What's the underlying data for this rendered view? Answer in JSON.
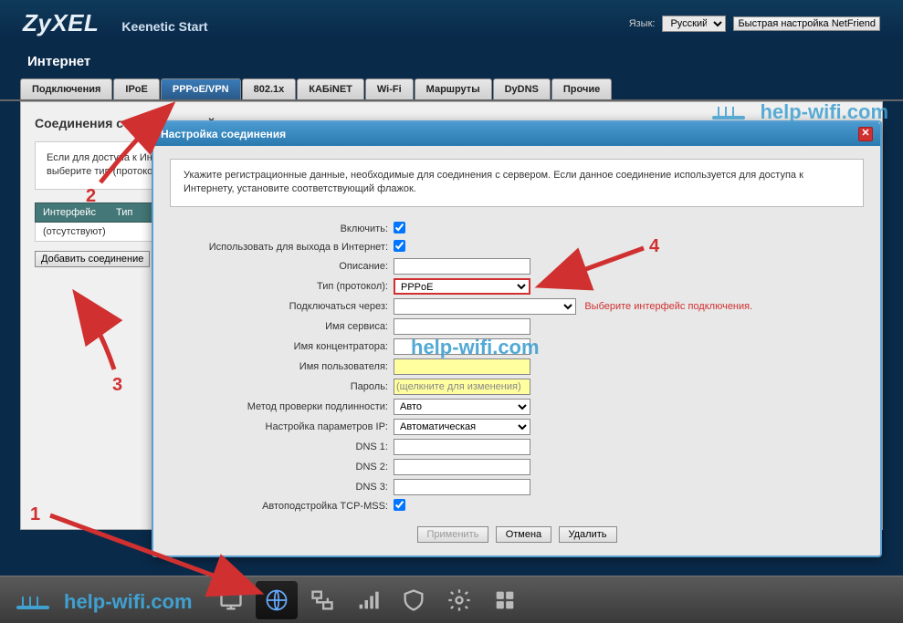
{
  "header": {
    "logo": "ZyXEL",
    "model": "Keenetic Start",
    "lang_label": "Язык:",
    "lang_value": "Русский",
    "quicksetup": "Быстрая настройка NetFriend"
  },
  "page_title": "Интернет",
  "tabs": [
    "Подключения",
    "IPoE",
    "PPPoE/VPN",
    "802.1x",
    "КАБiNET",
    "Wi-Fi",
    "Маршруты",
    "DyDNS",
    "Прочие"
  ],
  "active_tab_index": 2,
  "panel": {
    "title": "Соединения с авторизацией",
    "info": "Если для доступа к Интернету требуется установить авторизованное соединение, настройте его здесь. Укажите данные, предоставленные вам поставщиком услуг, выберите тип (протокол) соединения и подключение к корпоративной сети.",
    "th_interface": "Интерфейс",
    "th_type": "Тип",
    "row_empty": "(отсутствуют)",
    "add_btn": "Добавить соединение"
  },
  "modal": {
    "title": "Настройка соединения",
    "info": "Укажите регистрационные данные, необходимые для соединения с сервером. Если данное соединение используется для доступа к Интернету, установите соответствующий флажок.",
    "labels": {
      "enable": "Включить:",
      "use_for_internet": "Использовать для выхода в Интернет:",
      "description": "Описание:",
      "type": "Тип (протокол):",
      "connect_via": "Подключаться через:",
      "service_name": "Имя сервиса:",
      "concentrator": "Имя концентратора:",
      "username": "Имя пользователя:",
      "password": "Пароль:",
      "auth_method": "Метод проверки подлинности:",
      "ip_config": "Настройка параметров IP:",
      "dns1": "DNS 1:",
      "dns2": "DNS 2:",
      "dns3": "DNS 3:",
      "auto_mss": "Автоподстройка TCP-MSS:"
    },
    "values": {
      "type": "PPPoE",
      "connect_via": "",
      "auth_method": "Авто",
      "ip_config": "Автоматическая",
      "password_placeholder": "(щелкните для изменения)"
    },
    "error_connect_via": "Выберите интерфейс подключения.",
    "buttons": {
      "apply": "Применить",
      "cancel": "Отмена",
      "delete": "Удалить"
    }
  },
  "annotations": {
    "n1": "1",
    "n2": "2",
    "n3": "3",
    "n4": "4"
  },
  "watermark": "help-wifi.com"
}
